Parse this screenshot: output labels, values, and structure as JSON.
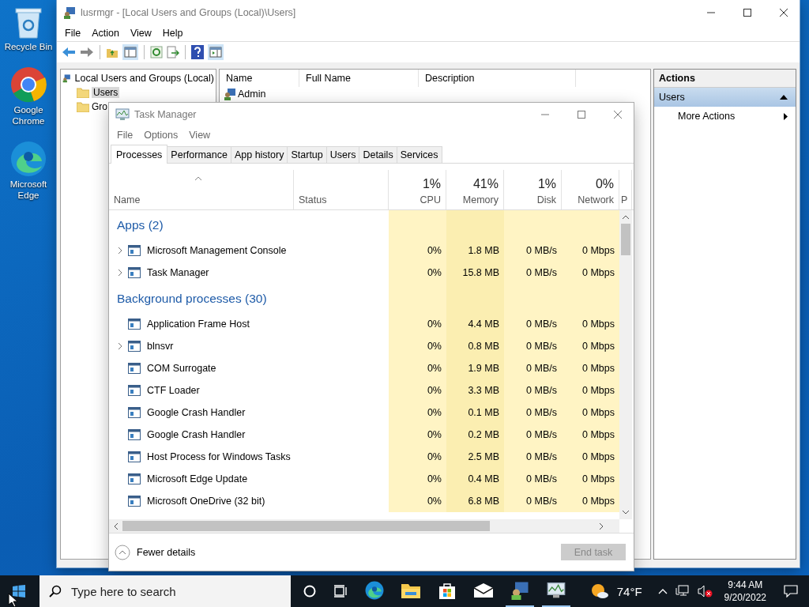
{
  "desktop_icons": [
    {
      "label": "Recycle Bin"
    },
    {
      "label": "Google Chrome"
    },
    {
      "label": "Microsoft Edge"
    }
  ],
  "mmc": {
    "title": "lusrmgr - [Local Users and Groups (Local)\\Users]",
    "menu": [
      "File",
      "Action",
      "View",
      "Help"
    ],
    "tree": {
      "label": "Local Users and Groups (Local)",
      "children": [
        {
          "label": "Users",
          "selected": true
        },
        {
          "label": "Gro",
          "selected": false
        }
      ]
    },
    "columns": [
      "Name",
      "Full Name",
      "Description"
    ],
    "rows": [
      {
        "name": "Admin"
      }
    ],
    "actions": {
      "title": "Actions",
      "section": "Users",
      "expanded": true,
      "items": [
        "More Actions"
      ]
    }
  },
  "task_manager": {
    "title": "Task Manager",
    "menu": [
      "File",
      "Options",
      "View"
    ],
    "tabs": [
      {
        "label": "Processes",
        "selected": true
      },
      {
        "label": "Performance",
        "selected": false
      },
      {
        "label": "App history",
        "selected": false
      },
      {
        "label": "Startup",
        "selected": false
      },
      {
        "label": "Users",
        "selected": false
      },
      {
        "label": "Details",
        "selected": false
      },
      {
        "label": "Services",
        "selected": false
      }
    ],
    "columns": [
      {
        "label": "Name"
      },
      {
        "label": "Status"
      },
      {
        "label": "CPU",
        "usage": "1%"
      },
      {
        "label": "Memory",
        "usage": "41%"
      },
      {
        "label": "Disk",
        "usage": "1%"
      },
      {
        "label": "Network",
        "usage": "0%"
      },
      {
        "label": "P"
      }
    ],
    "rows": [
      {
        "kind": "group",
        "label": "Apps (2)"
      },
      {
        "kind": "process",
        "name": "Microsoft Management Console",
        "expanded": false,
        "cpu": "0%",
        "memory": "1.8 MB",
        "disk": "0 MB/s",
        "network": "0 Mbps"
      },
      {
        "kind": "process",
        "name": "Task Manager",
        "expanded": false,
        "cpu": "0%",
        "memory": "15.8 MB",
        "disk": "0 MB/s",
        "network": "0 Mbps"
      },
      {
        "kind": "group",
        "label": "Background processes (30)"
      },
      {
        "kind": "process",
        "name": "Application Frame Host",
        "cpu": "0%",
        "memory": "4.4 MB",
        "disk": "0 MB/s",
        "network": "0 Mbps"
      },
      {
        "kind": "process",
        "name": "blnsvr",
        "expanded": false,
        "cpu": "0%",
        "memory": "0.8 MB",
        "disk": "0 MB/s",
        "network": "0 Mbps"
      },
      {
        "kind": "process",
        "name": "COM Surrogate",
        "cpu": "0%",
        "memory": "1.9 MB",
        "disk": "0 MB/s",
        "network": "0 Mbps"
      },
      {
        "kind": "process",
        "name": "CTF Loader",
        "cpu": "0%",
        "memory": "3.3 MB",
        "disk": "0 MB/s",
        "network": "0 Mbps"
      },
      {
        "kind": "process",
        "name": "Google Crash Handler",
        "cpu": "0%",
        "memory": "0.1 MB",
        "disk": "0 MB/s",
        "network": "0 Mbps"
      },
      {
        "kind": "process",
        "name": "Google Crash Handler",
        "cpu": "0%",
        "memory": "0.2 MB",
        "disk": "0 MB/s",
        "network": "0 Mbps"
      },
      {
        "kind": "process",
        "name": "Host Process for Windows Tasks",
        "cpu": "0%",
        "memory": "2.5 MB",
        "disk": "0 MB/s",
        "network": "0 Mbps"
      },
      {
        "kind": "process",
        "name": "Microsoft Edge Update",
        "cpu": "0%",
        "memory": "0.4 MB",
        "disk": "0 MB/s",
        "network": "0 Mbps"
      },
      {
        "kind": "process",
        "name": "Microsoft OneDrive (32 bit)",
        "cpu": "0%",
        "memory": "6.8 MB",
        "disk": "0 MB/s",
        "network": "0 Mbps"
      }
    ],
    "footer": {
      "toggle": "Fewer details",
      "button": "End task",
      "button_disabled": true
    }
  },
  "taskbar": {
    "search_placeholder": "Type here to search",
    "pinned": [
      {
        "running": false
      },
      {
        "running": false
      },
      {
        "running": false
      },
      {
        "running": false
      },
      {
        "running": true
      },
      {
        "running": true
      }
    ],
    "weather": "74°F",
    "volume_muted": true,
    "time": "9:44 AM",
    "date": "9/20/2022"
  }
}
